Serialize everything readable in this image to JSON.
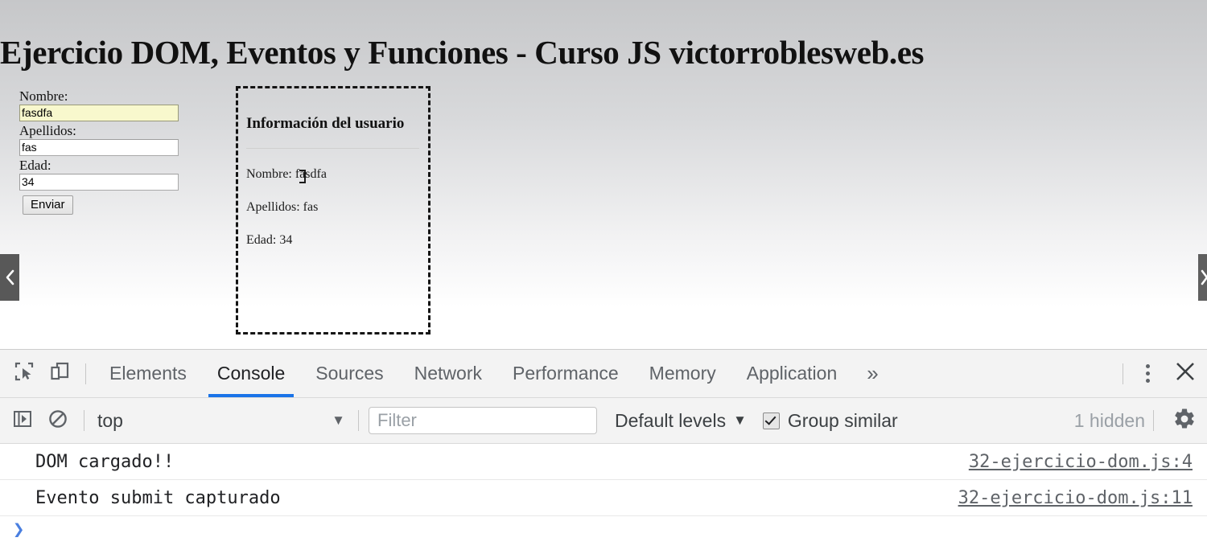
{
  "page": {
    "title": "Ejercicio DOM, Eventos y Funciones - Curso JS victorroblesweb.es",
    "form": {
      "fields": [
        {
          "label": "Nombre:",
          "value": "fasdfa",
          "name": "nombre-input",
          "autofilled": true
        },
        {
          "label": "Apellidos:",
          "value": "fas",
          "name": "apellidos-input",
          "autofilled": false
        },
        {
          "label": "Edad:",
          "value": "34",
          "name": "edad-input",
          "autofilled": false
        }
      ],
      "submit_label": "Enviar"
    },
    "user_info": {
      "title": "Información del usuario",
      "lines": [
        "Nombre: fasdfa",
        "Apellidos: fas",
        "Edad: 34"
      ]
    },
    "carousel": {
      "prev_icon": "chevron-left-icon",
      "next_icon": "chevron-right-icon"
    }
  },
  "devtools": {
    "inspect_icon": "inspect-element-icon",
    "device_toolbar_icon": "device-toolbar-icon",
    "tabs": [
      {
        "label": "Elements",
        "active": false
      },
      {
        "label": "Console",
        "active": true
      },
      {
        "label": "Sources",
        "active": false
      },
      {
        "label": "Network",
        "active": false
      },
      {
        "label": "Performance",
        "active": false
      },
      {
        "label": "Memory",
        "active": false
      },
      {
        "label": "Application",
        "active": false
      }
    ],
    "more_tabs_label": "»",
    "menu_icon": "kebab-menu-icon",
    "close_icon": "close-icon",
    "accent_color": "#1a73e8",
    "console_toolbar": {
      "sidebar_toggle_icon": "console-sidebar-toggle-icon",
      "clear_console_icon": "clear-console-icon",
      "context": "top",
      "context_caret": "▼",
      "filter_placeholder": "Filter",
      "filter_value": "",
      "levels_label": "Default levels",
      "levels_caret": "▼",
      "group_similar_label": "Group similar",
      "group_similar_checked": true,
      "hidden_count": "1 hidden",
      "settings_icon": "gear-icon"
    },
    "messages": [
      {
        "text": "DOM cargado!!",
        "source": "32-ejercicio-dom.js:4"
      },
      {
        "text": "Evento submit capturado",
        "source": "32-ejercicio-dom.js:11"
      }
    ],
    "prompt_caret": "❯"
  }
}
